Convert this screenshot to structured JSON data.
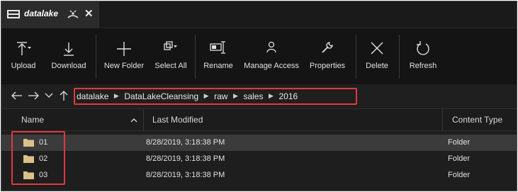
{
  "tab": {
    "title": "datalake",
    "close_glyph": "✕"
  },
  "toolbar": {
    "buttons": [
      {
        "label": "Upload",
        "icon": "upload-icon"
      },
      {
        "label": "Download",
        "icon": "download-icon"
      },
      {
        "label": "New Folder",
        "icon": "plus-icon"
      },
      {
        "label": "Select All",
        "icon": "select-all-icon"
      },
      {
        "label": "Rename",
        "icon": "rename-icon"
      },
      {
        "label": "Manage Access",
        "icon": "person-icon"
      },
      {
        "label": "Properties",
        "icon": "wrench-icon"
      },
      {
        "label": "Delete",
        "icon": "x-icon"
      },
      {
        "label": "Refresh",
        "icon": "refresh-icon"
      }
    ]
  },
  "nav": {
    "path": [
      "datalake",
      "DataLakeCleansing",
      "raw",
      "sales",
      "2016"
    ],
    "separator": "▶"
  },
  "columns": {
    "name": "Name",
    "modified": "Last Modified",
    "type": "Content Type"
  },
  "rows": [
    {
      "name": "01",
      "modified": "8/28/2019, 3:18:38 PM",
      "type": "Folder",
      "selected": true
    },
    {
      "name": "02",
      "modified": "8/28/2019, 3:18:38 PM",
      "type": "Folder",
      "selected": false
    },
    {
      "name": "03",
      "modified": "8/28/2019, 3:18:38 PM",
      "type": "Folder",
      "selected": false
    }
  ],
  "colors": {
    "highlight": "#e0393e",
    "folder": "#dcc08a",
    "background": "#1e1e1e",
    "selected_row": "#3b3b3b"
  }
}
